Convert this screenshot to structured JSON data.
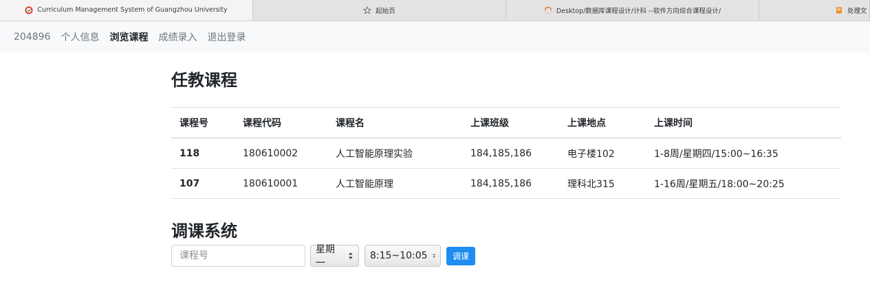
{
  "browser": {
    "tabs": [
      {
        "title": "Curriculum Management System of Guangzhou University",
        "icon": "university-logo-icon",
        "active": true
      },
      {
        "title": "起始页",
        "icon": "star-icon",
        "active": false
      },
      {
        "title": "Desktop/数据库课程设计/计科 --软件方向综合课程设计/",
        "icon": "loading-spinner-icon",
        "active": false
      },
      {
        "title": "处理文",
        "icon": "document-icon",
        "active": false
      }
    ]
  },
  "navbar": {
    "user_id": "204896",
    "items": [
      "个人信息",
      "浏览课程",
      "成绩录入",
      "退出登录"
    ],
    "active": "浏览课程"
  },
  "teaching": {
    "title": "任教课程",
    "columns": [
      "课程号",
      "课程代码",
      "课程名",
      "上课班级",
      "上课地点",
      "上课时间"
    ],
    "rows": [
      [
        "118",
        "180610002",
        "人工智能原理实验",
        "184,185,186",
        "电子楼102",
        "1-8周/星期四/15:00~16:35"
      ],
      [
        "107",
        "180610001",
        "人工智能原理",
        "184,185,186",
        "理科北315",
        "1-16周/星期五/18:00~20:25"
      ]
    ]
  },
  "adjust": {
    "title": "调课系统",
    "course_placeholder": "课程号",
    "day_selected": "星期一",
    "time_selected": "8:15~10:05",
    "submit_label": "调课"
  },
  "colors": {
    "primary": "#1e8cf0",
    "navbar_bg": "#f8f9fa",
    "tabbar_bg": "#e3e3e3"
  }
}
